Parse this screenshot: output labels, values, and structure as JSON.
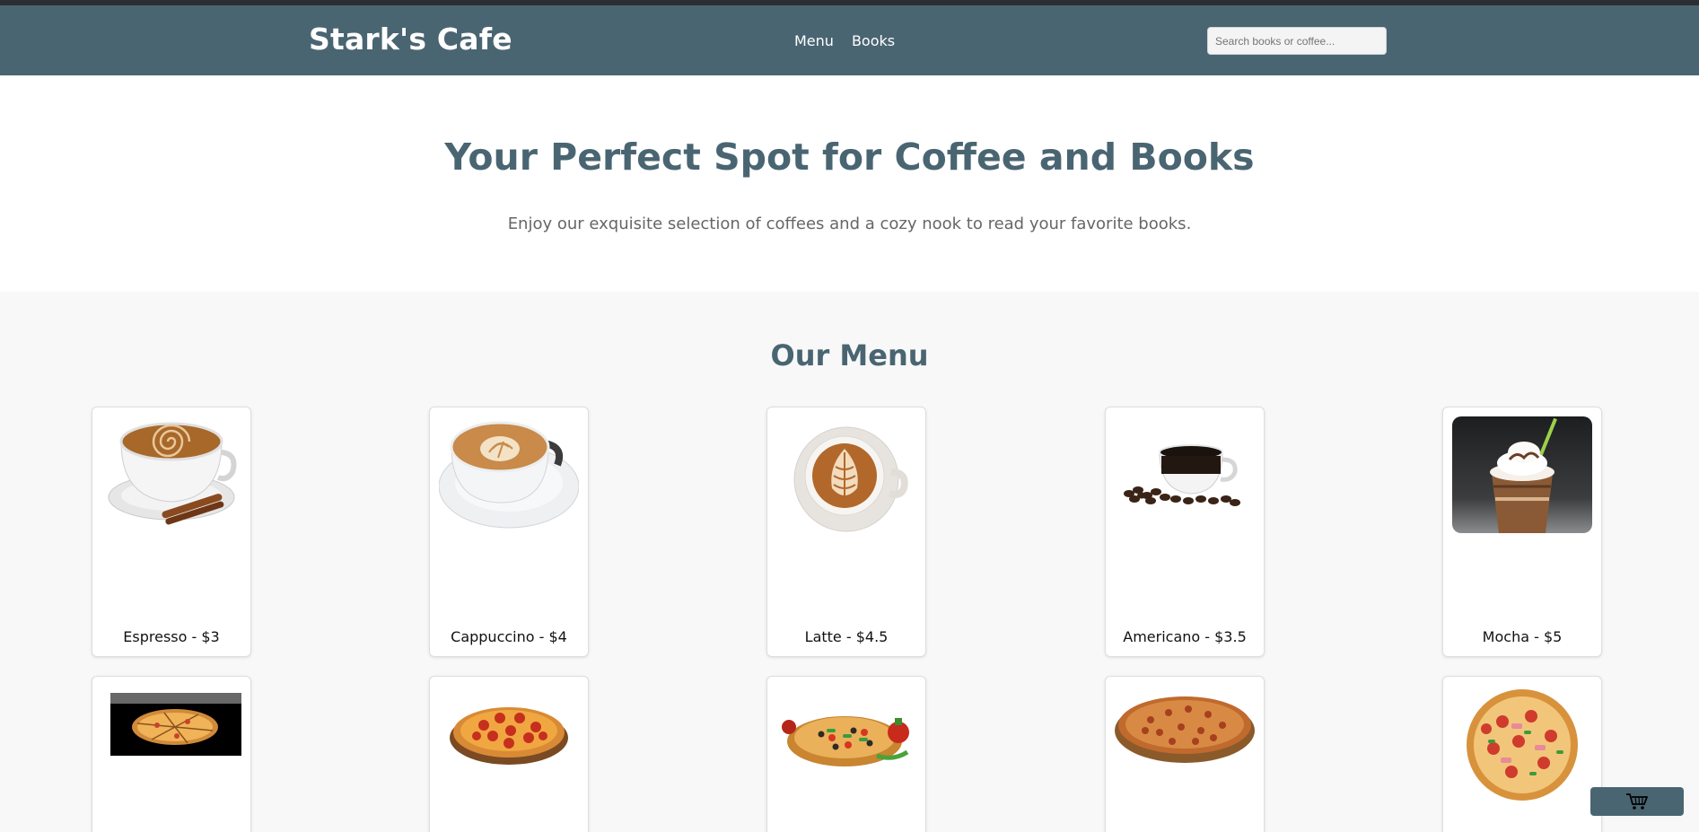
{
  "header": {
    "brand": "Stark's Cafe",
    "nav": [
      {
        "label": "Menu"
      },
      {
        "label": "Books"
      }
    ],
    "search": {
      "placeholder": "Search books or coffee...",
      "value": ""
    }
  },
  "hero": {
    "title": "Your Perfect Spot for Coffee and Books",
    "subtitle": "Enjoy our exquisite selection of coffees and a cozy nook to read your favorite books."
  },
  "menu": {
    "title": "Our Menu",
    "items": [
      {
        "label": "Espresso - $3",
        "image": "espresso-cup-image"
      },
      {
        "label": "Cappuccino - $4",
        "image": "cappuccino-cup-image"
      },
      {
        "label": "Latte - $4.5",
        "image": "latte-cup-image"
      },
      {
        "label": "Americano - $3.5",
        "image": "americano-cup-image"
      },
      {
        "label": "Mocha - $5",
        "image": "mocha-drink-image"
      },
      {
        "label": "",
        "image": "pizza-image"
      },
      {
        "label": "",
        "image": "pepperoni-pizza-image"
      },
      {
        "label": "",
        "image": "vegetable-pizza-image"
      },
      {
        "label": "",
        "image": "meat-pizza-image"
      },
      {
        "label": "",
        "image": "supreme-pizza-image"
      }
    ]
  },
  "cart": {
    "icon": "cart-icon"
  },
  "colors": {
    "header": "#4a6572",
    "accent": "#4a6572",
    "background": "#f8f8f8"
  }
}
